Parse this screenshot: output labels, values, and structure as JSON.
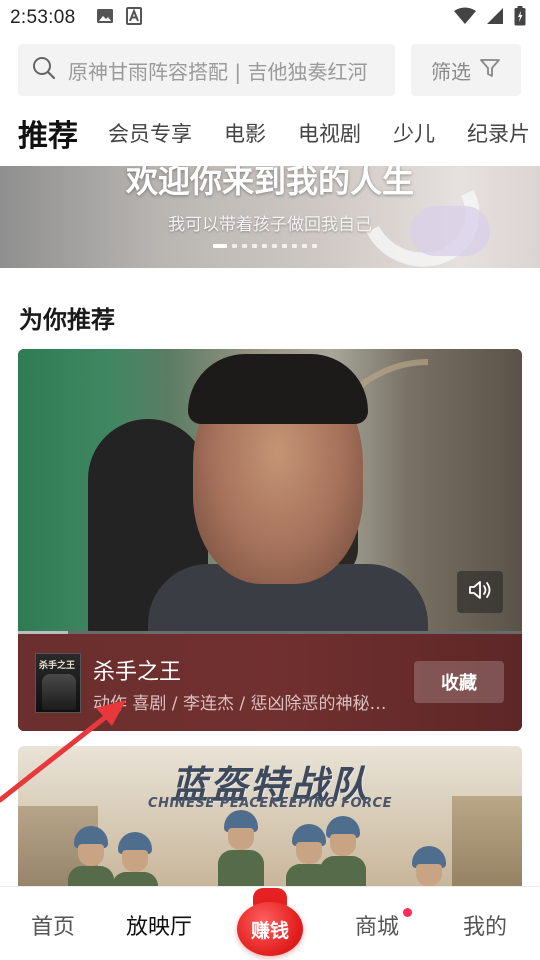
{
  "status_bar": {
    "time": "2:53:08",
    "icons": [
      "image-icon",
      "font-icon",
      "wifi-icon",
      "signal-icon",
      "battery-icon"
    ]
  },
  "search": {
    "placeholder": "原神甘雨阵容搭配 | 吉他独奏红河",
    "filter_label": "筛选"
  },
  "tabs": [
    {
      "label": "推荐",
      "active": true
    },
    {
      "label": "会员专享",
      "active": false
    },
    {
      "label": "电影",
      "active": false
    },
    {
      "label": "电视剧",
      "active": false
    },
    {
      "label": "少儿",
      "active": false
    },
    {
      "label": "纪录片",
      "active": false
    }
  ],
  "banner": {
    "title": "欢迎你来到我的人生",
    "subtitle": "我可以带着孩子做回我自己",
    "dot_count": 10,
    "active_dot": 0
  },
  "section": {
    "title": "为你推荐"
  },
  "featured": {
    "poster_text": "杀手之王",
    "title": "杀手之王",
    "meta": "动作 喜剧 / 李连杰 / 惩凶除恶的神秘杀手",
    "collect_label": "收藏",
    "progress": 0.1
  },
  "second_card": {
    "title": "蓝盔特战队",
    "subtitle": "CHINESE PEACEKEEPING FORCE"
  },
  "bottom_nav": {
    "home": "首页",
    "cinema": "放映厅",
    "earn": "赚钱",
    "shop": "商城",
    "mine": "我的"
  },
  "colors": {
    "accent_red": "#e01b1b",
    "info_bar": "#6a2f2e",
    "annotation_arrow": "#e8383b"
  }
}
